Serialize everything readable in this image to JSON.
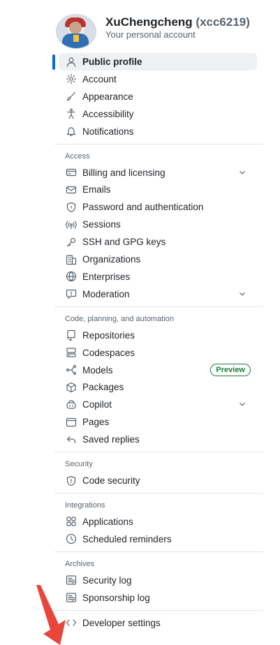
{
  "account": {
    "display_name": "XuChengcheng",
    "handle": "(xcc6219)",
    "subtitle": "Your personal account"
  },
  "nav": {
    "top_items": [
      {
        "label": "Public profile",
        "icon": "person-icon",
        "active": true
      },
      {
        "label": "Account",
        "icon": "gear-icon"
      },
      {
        "label": "Appearance",
        "icon": "paintbrush-icon"
      },
      {
        "label": "Accessibility",
        "icon": "accessibility-icon"
      },
      {
        "label": "Notifications",
        "icon": "bell-icon"
      }
    ],
    "sections": [
      {
        "title": "Access",
        "items": [
          {
            "label": "Billing and licensing",
            "icon": "credit-card-icon",
            "expandable": true
          },
          {
            "label": "Emails",
            "icon": "mail-icon"
          },
          {
            "label": "Password and authentication",
            "icon": "shield-lock-icon"
          },
          {
            "label": "Sessions",
            "icon": "broadcast-icon"
          },
          {
            "label": "SSH and GPG keys",
            "icon": "key-icon"
          },
          {
            "label": "Organizations",
            "icon": "organization-icon"
          },
          {
            "label": "Enterprises",
            "icon": "globe-icon"
          },
          {
            "label": "Moderation",
            "icon": "report-icon",
            "expandable": true
          }
        ]
      },
      {
        "title": "Code, planning, and automation",
        "items": [
          {
            "label": "Repositories",
            "icon": "repo-icon"
          },
          {
            "label": "Codespaces",
            "icon": "codespaces-icon"
          },
          {
            "label": "Models",
            "icon": "models-icon",
            "badge": "Preview"
          },
          {
            "label": "Packages",
            "icon": "package-icon"
          },
          {
            "label": "Copilot",
            "icon": "copilot-icon",
            "expandable": true
          },
          {
            "label": "Pages",
            "icon": "browser-icon"
          },
          {
            "label": "Saved replies",
            "icon": "reply-icon"
          }
        ]
      },
      {
        "title": "Security",
        "items": [
          {
            "label": "Code security",
            "icon": "shield-check-icon"
          }
        ]
      },
      {
        "title": "Integrations",
        "items": [
          {
            "label": "Applications",
            "icon": "apps-icon"
          },
          {
            "label": "Scheduled reminders",
            "icon": "clock-icon"
          }
        ]
      },
      {
        "title": "Archives",
        "items": [
          {
            "label": "Security log",
            "icon": "log-icon"
          },
          {
            "label": "Sponsorship log",
            "icon": "log-icon"
          }
        ]
      }
    ],
    "bottom_item": {
      "label": "Developer settings",
      "icon": "code-icon"
    }
  },
  "colors": {
    "accent": "#0969da",
    "active_bg": "#eef0f3",
    "badge_green": "#1a7f37",
    "annotation_arrow": "#e8453c"
  }
}
